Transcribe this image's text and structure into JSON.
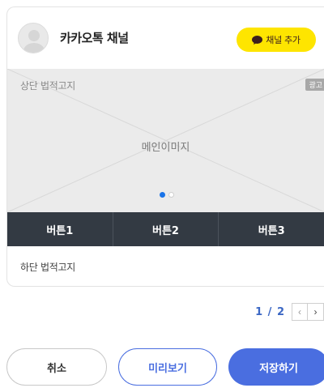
{
  "channel": {
    "name": "카카오톡 채널",
    "add_button_label": "채널 추가",
    "add_button_icon": "kakaotalk-icon",
    "brand_color": "#fee500"
  },
  "message": {
    "legal_top": "상단 법적고지",
    "ad_badge": "광고",
    "main_image_label": "메인이미지",
    "carousel": {
      "current_index": 0,
      "total": 2
    },
    "buttons": [
      "버튼1",
      "버튼2",
      "버튼3"
    ],
    "legal_bottom": "하단 법적고지"
  },
  "pagination": {
    "text": "1 / 2",
    "prev_icon": "chevron-left-icon",
    "next_icon": "chevron-right-icon"
  },
  "footer": {
    "cancel_label": "취소",
    "preview_label": "미리보기",
    "save_label": "저장하기",
    "accent_color": "#4a6ee0"
  }
}
